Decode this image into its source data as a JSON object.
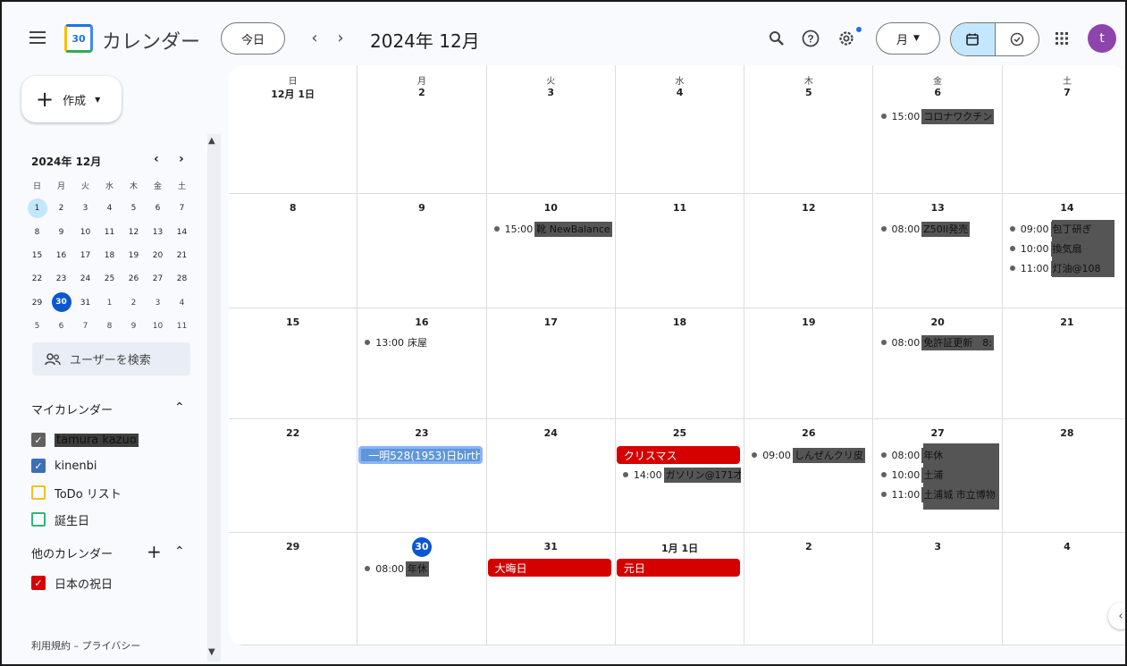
{
  "header": {
    "app_title": "カレンダー",
    "logo_text": "30",
    "today_label": "今日",
    "prev": "‹",
    "next": "›",
    "period": "2024年 12月",
    "view_label": "月",
    "avatar_initial": "t",
    "icons": [
      "menu-icon",
      "search-icon",
      "help-icon",
      "settings-icon",
      "calendar-view-icon",
      "tasks-view-icon",
      "apps-grid-icon"
    ]
  },
  "sidebar": {
    "create_label": "作成",
    "mini_calendar": {
      "title": "2024年 12月",
      "weekdays": [
        "日",
        "月",
        "火",
        "水",
        "木",
        "金",
        "土"
      ],
      "weeks": [
        [
          "1",
          "2",
          "3",
          "4",
          "5",
          "6",
          "7"
        ],
        [
          "8",
          "9",
          "10",
          "11",
          "12",
          "13",
          "14"
        ],
        [
          "15",
          "16",
          "17",
          "18",
          "19",
          "20",
          "21"
        ],
        [
          "22",
          "23",
          "24",
          "25",
          "26",
          "27",
          "28"
        ],
        [
          "29",
          "30",
          "31",
          "1",
          "2",
          "3",
          "4"
        ],
        [
          "5",
          "6",
          "7",
          "8",
          "9",
          "10",
          "11"
        ]
      ],
      "selected": "1",
      "today": "30"
    },
    "search_users": "ユーザーを検索",
    "my_calendars_title": "マイカレンダー",
    "my_calendars": [
      {
        "label": "tamura kazuo",
        "color": "#616161",
        "checked": true
      },
      {
        "label": "kinenbi",
        "color": "#3f6fb5",
        "checked": true
      },
      {
        "label": "ToDo リスト",
        "color": "#f6bf26",
        "checked": false
      },
      {
        "label": "誕生日",
        "color": "#33b679",
        "checked": false
      }
    ],
    "other_calendars_title": "他のカレンダー",
    "other_calendars": [
      {
        "label": "日本の祝日",
        "color": "#d50000",
        "checked": true
      }
    ],
    "footer": "利用規約 – プライバシー"
  },
  "month": {
    "weekdays": [
      "日",
      "月",
      "火",
      "水",
      "木",
      "金",
      "土"
    ],
    "weeks": [
      [
        "12月 1日",
        "2",
        "3",
        "4",
        "5",
        "6",
        "7"
      ],
      [
        "8",
        "9",
        "10",
        "11",
        "12",
        "13",
        "14"
      ],
      [
        "15",
        "16",
        "17",
        "18",
        "19",
        "20",
        "21"
      ],
      [
        "22",
        "23",
        "24",
        "25",
        "26",
        "27",
        "28"
      ],
      [
        "29",
        "30",
        "31",
        "1月 1日",
        "2",
        "3",
        "4"
      ]
    ],
    "events": {
      "w0_fri": {
        "time": "15:00",
        "title": "コロナワクチン"
      },
      "w1_tue": {
        "time": "15:00",
        "title": "靴 NewBalance"
      },
      "w1_fri": {
        "time": "08:00",
        "title": "Z50II発売"
      },
      "w1_sat": [
        {
          "time": "09:00",
          "title": "包丁研ぎ"
        },
        {
          "time": "10:00",
          "title": "換気扇"
        },
        {
          "time": "11:00",
          "title": "灯油@108"
        }
      ],
      "w2_mon": {
        "time": "13:00",
        "title": "床屋"
      },
      "w2_fri": {
        "time": "08:00",
        "title": "免許証更新　8:"
      },
      "w3_mon_allday": "一明528(1953)日birth",
      "w3_wed_allday": "クリスマス",
      "w3_wed": {
        "time": "14:00",
        "title": "ガソリン@171才"
      },
      "w3_thu": {
        "time": "09:00",
        "title": "しんぜんクリ皮"
      },
      "w3_fri": [
        {
          "time": "08:00",
          "title": "年休"
        },
        {
          "time": "10:00",
          "title": "土浦"
        },
        {
          "time": "11:00",
          "title": "土浦城 市立博物"
        }
      ],
      "w4_mon": {
        "time": "08:00",
        "title": "年休"
      },
      "w4_tue_allday": "大晦日",
      "w4_wed_allday": "元日"
    }
  }
}
